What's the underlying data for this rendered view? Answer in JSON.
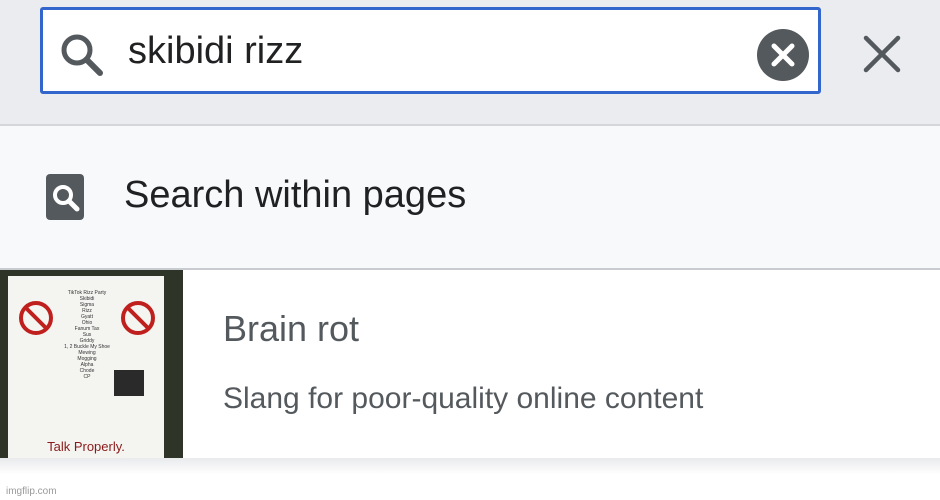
{
  "search": {
    "query": "skibidi rizz",
    "search_icon": "search-icon",
    "clear_icon": "clear-circle-icon",
    "close_icon": "close-icon"
  },
  "within": {
    "label": "Search within pages",
    "icon": "page-search-icon"
  },
  "results": [
    {
      "title": "Brain rot",
      "description": "Slang for poor-quality online content",
      "thumbnail": {
        "words": [
          "TikTok Rizz Party",
          "Skibidi",
          "Sigma",
          "Rizz",
          "Gyatt",
          "Ohio",
          "Fanum Tax",
          "Sus",
          "Griddy",
          "1, 2 Buckle My Shoe",
          "Mewing",
          "Mogging",
          "Alpha",
          "Chode",
          "CP"
        ],
        "footer": "Talk Properly."
      }
    }
  ],
  "watermark": "imgflip.com",
  "colors": {
    "accent": "#3366cc",
    "topbar_bg": "#eaecf0",
    "row_bg": "#f8f9fa",
    "text": "#202122",
    "subtle_text": "#54595d"
  }
}
